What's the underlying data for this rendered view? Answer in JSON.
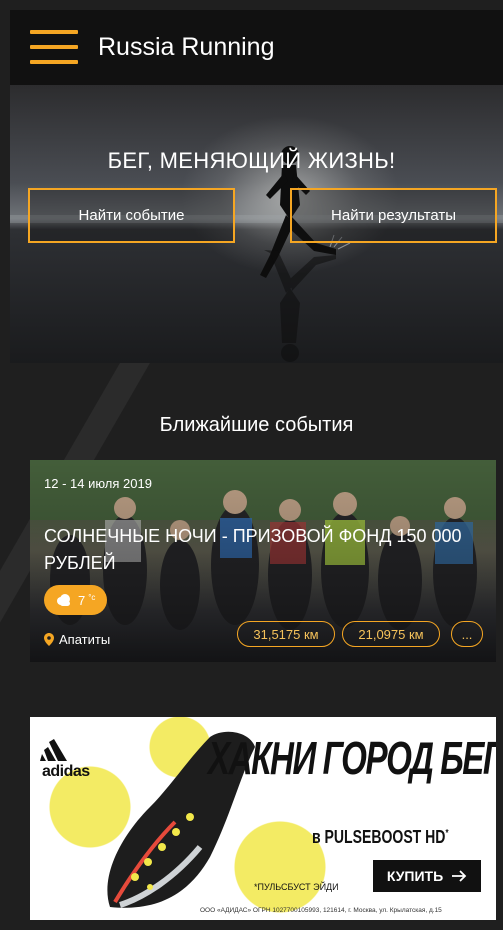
{
  "app_bar": {
    "title": "Russia Running"
  },
  "hero": {
    "headline": "БЕГ, МЕНЯЮЩИЙ ЖИЗНЬ!",
    "find_event_label": "Найти событие",
    "find_results_label": "Найти результаты"
  },
  "upcoming": {
    "section_title": "Ближайшие события",
    "events": [
      {
        "date": "12 - 14 июля 2019",
        "title": "СОЛНЕЧНЫЕ НОЧИ - ПРИЗОВОЙ ФОНД 150 000 РУБЛЕЙ",
        "weather": {
          "temperature": "7",
          "unit": "°c",
          "icon": "cloud-sun-icon"
        },
        "location": "Апатиты",
        "distances": [
          "31,5175 км",
          "21,0975 км"
        ],
        "more_label": "..."
      }
    ]
  },
  "ad": {
    "brand": "adidas",
    "headline": "ХАКНИ ГОРОД БЕГОМ",
    "subline": "в PULSEBOOST HD",
    "subline_mark": "*",
    "buy_label": "КУПИТЬ",
    "note": "*ПУЛЬСБУСТ ЭЙДИ",
    "legal": "ООО «АДИДАС» ОГРН 1027700105993, 121614, г. Москва, ул. Крылатская, д.15"
  },
  "colors": {
    "accent": "#f5a623",
    "app_bar_bg": "#111111",
    "page_bg": "#1f1f1f"
  }
}
